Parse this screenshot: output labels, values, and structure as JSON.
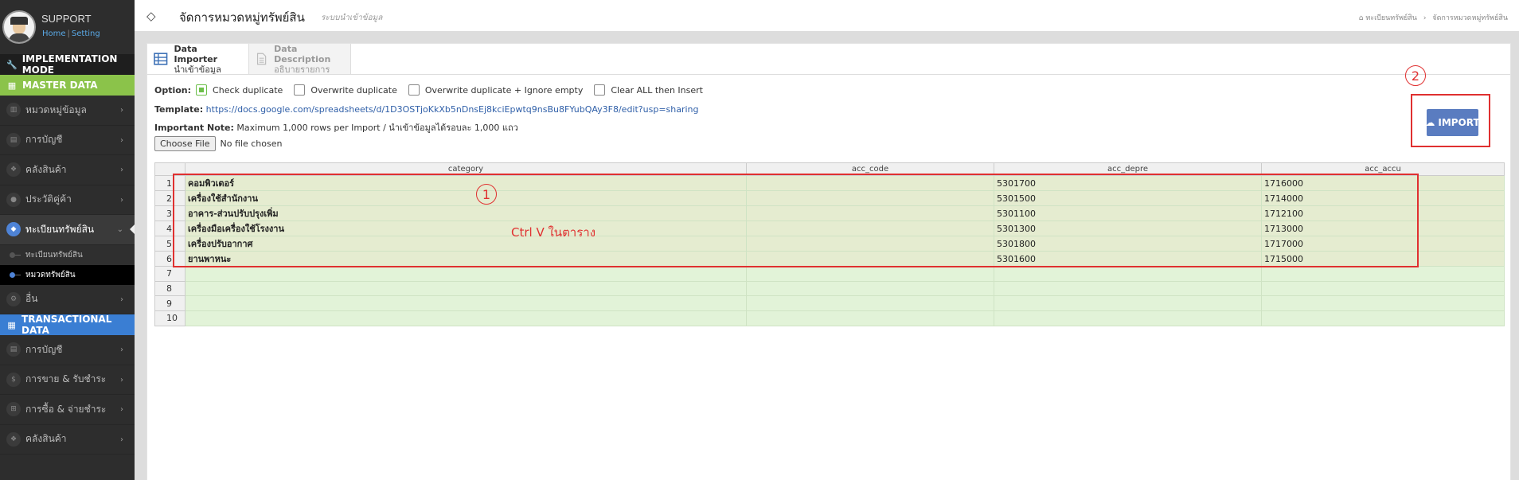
{
  "brand": {
    "title": "SUPPORT",
    "home": "Home",
    "separator": "|",
    "setting": "Setting"
  },
  "sidebar": {
    "impl_label": "IMPLEMENTATION MODE",
    "master_label": "MASTER DATA",
    "master_items": [
      {
        "label": "หมวดหมู่ข้อมูล",
        "icon": "book-icon"
      },
      {
        "label": "การบัญชี",
        "icon": "ledger-icon"
      },
      {
        "label": "คลังสินค้า",
        "icon": "cubes-icon"
      },
      {
        "label": "ประวัติคู่ค้า",
        "icon": "user-icon"
      },
      {
        "label": "ทะเบียนทรัพย์สิน",
        "icon": "diamond-icon"
      }
    ],
    "sub_items": [
      {
        "label": "ทะเบียนทรัพย์สิน"
      },
      {
        "label": "หมวดทรัพย์สิน"
      }
    ],
    "other_item": {
      "label": "อื่น",
      "icon": "gear-icon"
    },
    "trans_label": "TRANSACTIONAL DATA",
    "trans_items": [
      {
        "label": "การบัญชี",
        "icon": "ledger-icon"
      },
      {
        "label": "การขาย & รับชำระ",
        "icon": "dollar-icon"
      },
      {
        "label": "การซื้อ & จ่ายชำระ",
        "icon": "cart-icon"
      },
      {
        "label": "คลังสินค้า",
        "icon": "cubes-icon"
      }
    ]
  },
  "header": {
    "title": "จัดการหมวดหมู่ทรัพย์สิน",
    "subtitle": "ระบบนำเข้าข้อมูล",
    "breadcrumb": [
      "ทะเบียนทรัพย์สิน",
      "จัดการหมวดหมู่ทรัพย์สิน"
    ]
  },
  "tabs": [
    {
      "main": "Data Importer",
      "sub": "นำเข้าข้อมูล"
    },
    {
      "main": "Data Description",
      "sub": "อธิบายรายการ"
    }
  ],
  "options": {
    "label": "Option:",
    "items": [
      {
        "label": "Check duplicate",
        "checked": true
      },
      {
        "label": "Overwrite duplicate",
        "checked": false
      },
      {
        "label": "Overwrite duplicate + Ignore empty",
        "checked": false
      },
      {
        "label": "Clear ALL then Insert",
        "checked": false
      }
    ]
  },
  "template": {
    "label": "Template:",
    "url": "https://docs.google.com/spreadsheets/d/1D3OSTjoKkXb5nDnsEj8kciEpwtq9nsBu8FYubQAy3F8/edit?usp=sharing"
  },
  "note": {
    "label": "Important Note:",
    "text": "Maximum 1,000 rows per Import / นำเข้าข้อมูลได้รอบละ 1,000 แถว"
  },
  "file": {
    "button": "Choose File",
    "status": "No file chosen"
  },
  "import": {
    "label": "IMPORT"
  },
  "annotations": {
    "circle1": "1",
    "circle2": "2",
    "ctrlv": "Ctrl  V ในตาราง"
  },
  "grid": {
    "columns": [
      "category",
      "acc_code",
      "acc_depre",
      "acc_accu"
    ],
    "rows": [
      {
        "n": "1",
        "category": "คอมพิวเตอร์",
        "acc_code": "",
        "acc_depre": "5301700",
        "acc_accu": "1716000"
      },
      {
        "n": "2",
        "category": "เครื่องใช้สำนักงาน",
        "acc_code": "",
        "acc_depre": "5301500",
        "acc_accu": "1714000"
      },
      {
        "n": "3",
        "category": "อาคาร-ส่วนปรับปรุงเพิ่ม",
        "acc_code": "",
        "acc_depre": "5301100",
        "acc_accu": "1712100"
      },
      {
        "n": "4",
        "category": "เครื่องมือเครื่องใช้โรงงาน",
        "acc_code": "",
        "acc_depre": "5301300",
        "acc_accu": "1713000"
      },
      {
        "n": "5",
        "category": "เครื่องปรับอากาศ",
        "acc_code": "",
        "acc_depre": "5301800",
        "acc_accu": "1717000"
      },
      {
        "n": "6",
        "category": "ยานพาหนะ",
        "acc_code": "",
        "acc_depre": "5301600",
        "acc_accu": "1715000"
      },
      {
        "n": "7",
        "category": "",
        "acc_code": "",
        "acc_depre": "",
        "acc_accu": ""
      },
      {
        "n": "8",
        "category": "",
        "acc_code": "",
        "acc_depre": "",
        "acc_accu": ""
      },
      {
        "n": "9",
        "category": "",
        "acc_code": "",
        "acc_depre": "",
        "acc_accu": ""
      },
      {
        "n": "10",
        "category": "",
        "acc_code": "",
        "acc_depre": "",
        "acc_accu": ""
      }
    ]
  },
  "colors": {
    "master": "#8bc34a",
    "trans": "#3a7ed3",
    "import": "#5a7cc0",
    "annotation": "#e03030",
    "grid_cell": "#e2f3d8"
  }
}
